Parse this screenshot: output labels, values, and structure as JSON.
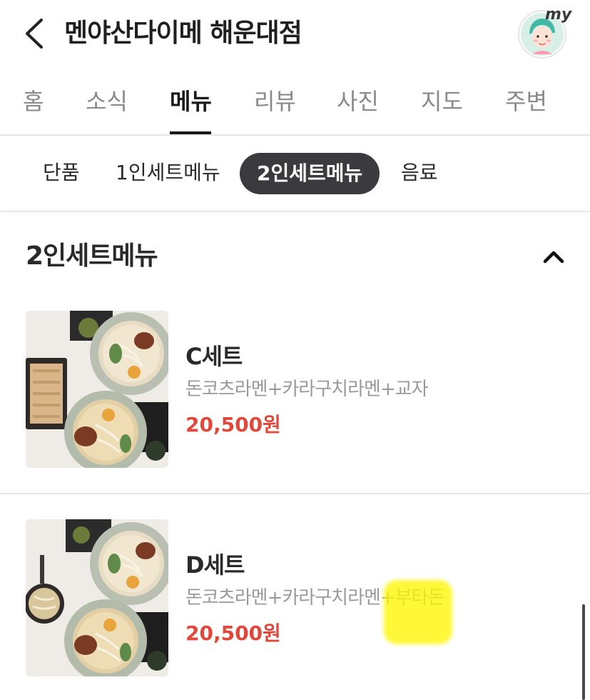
{
  "header": {
    "title": "멘야산다이메 해운대점",
    "avatar_badge": "my"
  },
  "tabs": [
    {
      "label": "홈",
      "active": false
    },
    {
      "label": "소식",
      "active": false
    },
    {
      "label": "메뉴",
      "active": true
    },
    {
      "label": "리뷰",
      "active": false
    },
    {
      "label": "사진",
      "active": false
    },
    {
      "label": "지도",
      "active": false
    },
    {
      "label": "주변",
      "active": false
    }
  ],
  "subtabs": [
    {
      "label": "단품",
      "active": false
    },
    {
      "label": "1인세트메뉴",
      "active": false
    },
    {
      "label": "2인세트메뉴",
      "active": true
    },
    {
      "label": "음료",
      "active": false
    }
  ],
  "section": {
    "title": "2인세트메뉴"
  },
  "menu_items": [
    {
      "name": "C세트",
      "description": "돈코츠라멘+카라구치라멘+교자",
      "price": "20,500원"
    },
    {
      "name": "D세트",
      "description": "돈코츠라멘+카라구치라멘+부타돈",
      "price": "20,500원"
    }
  ],
  "colors": {
    "price": "#e0483c",
    "active_chip": "#3b3b3f",
    "highlight": "#fff600"
  },
  "icons": {
    "back": "chevron-left-icon",
    "collapse": "chevron-up-icon",
    "avatar": "avatar-icon"
  }
}
